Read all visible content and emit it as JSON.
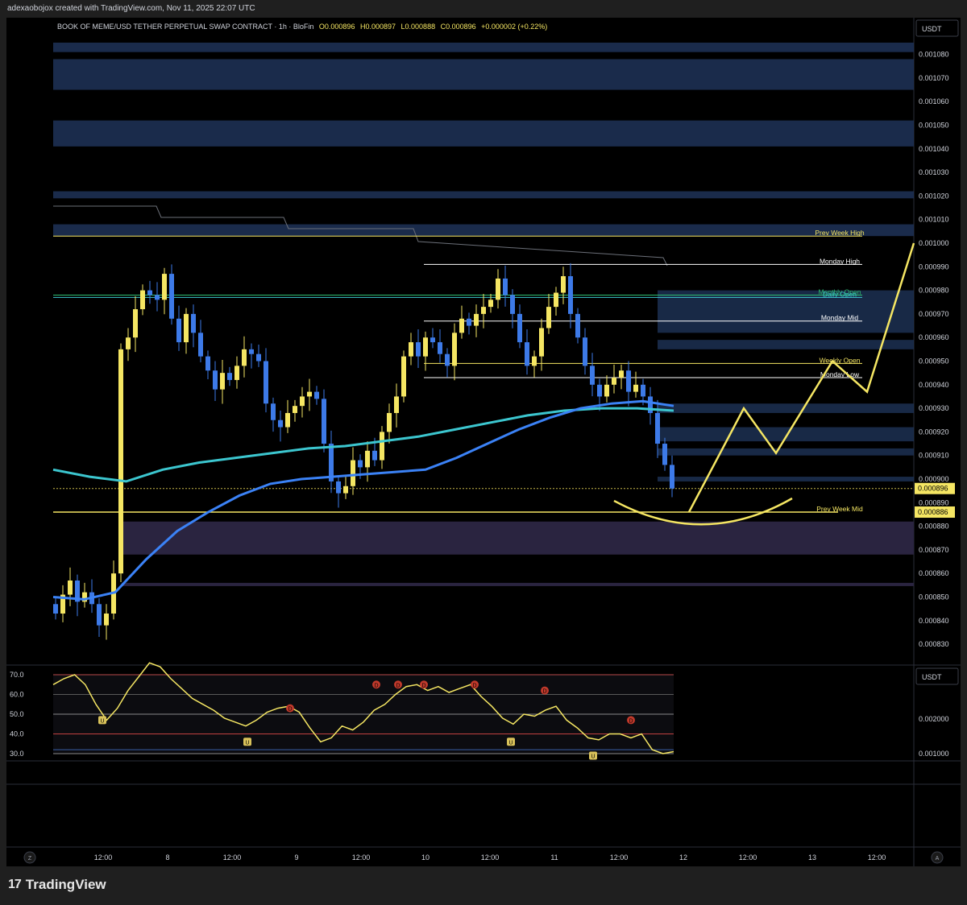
{
  "credit": "adexaobojox created with TradingView.com, Nov 11, 2025 22:07 UTC",
  "brand": {
    "logo": "17",
    "name": "TradingView"
  },
  "colors": {
    "background": "#000000",
    "bull": "#f5e663",
    "bear": "#3d7ae8",
    "ema_fast": "#3b82f6",
    "ema_slow": "#3cc6cf",
    "zone": "#1e3358",
    "purple_zone": "#2a2440",
    "projection": "#f5e663",
    "rsi": "#f5e663"
  },
  "header": {
    "symbol": "BOOK OF MEME/USD TETHER PERPETUAL SWAP CONTRACT · 1h · BloFin",
    "o": "O0.000896",
    "h": "H0.000897",
    "l": "L0.000888",
    "c": "C0.000896",
    "chg": "+0.000002 (+0.22%)"
  },
  "price_axis": {
    "currency": "USDT",
    "ticks": [
      "0.001080",
      "0.001070",
      "0.001060",
      "0.001050",
      "0.001040",
      "0.001030",
      "0.001020",
      "0.001010",
      "0.001000",
      "0.000990",
      "0.000980",
      "0.000970",
      "0.000960",
      "0.000950",
      "0.000940",
      "0.000930",
      "0.000920",
      "0.000910",
      "0.000900",
      "0.000890",
      "0.000880",
      "0.000870",
      "0.000860",
      "0.000850",
      "0.000840",
      "0.000830"
    ],
    "last_price": "0.000896",
    "level_price": "0.000886"
  },
  "time_axis": {
    "labels": [
      "12:00",
      "8",
      "12:00",
      "9",
      "12:00",
      "10",
      "12:00",
      "11",
      "12:00",
      "12",
      "12:00",
      "13",
      "12:00"
    ],
    "left_button": "Z",
    "right_button": "A"
  },
  "levels": [
    {
      "label": "Prev Week High",
      "price": 0.001003,
      "color": "#f5e663"
    },
    {
      "label": "Monday High",
      "price": 0.000991,
      "color": "#ffffff"
    },
    {
      "label": "Monthly Open",
      "price": 0.000978,
      "color": "#2fbf71"
    },
    {
      "label": "Daily Open",
      "price": 0.000977,
      "color": "#3cc6cf"
    },
    {
      "label": "Monday Mid",
      "price": 0.000967,
      "color": "#ffffff"
    },
    {
      "label": "Weekly Open",
      "price": 0.000949,
      "color": "#f5e663"
    },
    {
      "label": "Monday Low",
      "price": 0.000943,
      "color": "#ffffff"
    },
    {
      "label": "Prev Week Mid",
      "price": 0.000886,
      "color": "#f5e663"
    }
  ],
  "rsi": {
    "ticks": [
      "70.0",
      "60.0",
      "50.0",
      "40.0",
      "30.0"
    ],
    "right_currency": "USDT",
    "right_ticks": [
      "0.002000",
      "0.001000"
    ],
    "markers": [
      {
        "t": "D",
        "x": 360,
        "v": 53
      },
      {
        "t": "D",
        "x": 467,
        "v": 65
      },
      {
        "t": "D",
        "x": 494,
        "v": 65
      },
      {
        "t": "D",
        "x": 526,
        "v": 65
      },
      {
        "t": "D",
        "x": 589,
        "v": 65
      },
      {
        "t": "D",
        "x": 676,
        "v": 62
      },
      {
        "t": "D",
        "x": 783,
        "v": 47
      },
      {
        "t": "U",
        "x": 127,
        "v": 47
      },
      {
        "t": "U",
        "x": 307,
        "v": 36
      },
      {
        "t": "U",
        "x": 634,
        "v": 36
      },
      {
        "t": "U",
        "x": 736,
        "v": 29
      }
    ]
  },
  "chart_data": {
    "type": "candlestick",
    "title": "BOOK OF MEME/USD TETHER PERPETUAL SWAP CONTRACT · 1h · BloFin",
    "timeframe": "1h",
    "x_labels": [
      "12:00",
      "8",
      "12:00",
      "9",
      "12:00",
      "10",
      "12:00",
      "11",
      "12:00",
      "12",
      "12:00",
      "13",
      "12:00"
    ],
    "y_ticks": [
      "0.001080",
      "0.001070",
      "0.001060",
      "0.001050",
      "0.001040",
      "0.001030",
      "0.001020",
      "0.001010",
      "0.001000",
      "0.000990",
      "0.000980",
      "0.000970",
      "0.000960",
      "0.000950",
      "0.000940",
      "0.000930",
      "0.000920",
      "0.000910",
      "0.000900",
      "0.000890",
      "0.000880",
      "0.000870",
      "0.000860",
      "0.000850",
      "0.000840",
      "0.000830"
    ],
    "ylim": [
      0.000822,
      0.001089
    ],
    "ohlc_last": {
      "o": 0.000896,
      "h": 0.000897,
      "l": 0.000888,
      "c": 0.000896
    },
    "close_path": [
      0.000843,
      0.000851,
      0.000857,
      0.000848,
      0.000852,
      0.000847,
      0.000838,
      0.000843,
      0.00086,
      0.000955,
      0.00096,
      0.000972,
      0.00098,
      0.000978,
      0.000976,
      0.000987,
      0.000968,
      0.000958,
      0.00097,
      0.000962,
      0.000952,
      0.000946,
      0.000938,
      0.000945,
      0.000942,
      0.000948,
      0.000955,
      0.000953,
      0.00095,
      0.000932,
      0.000925,
      0.000922,
      0.000928,
      0.000931,
      0.000935,
      0.000937,
      0.000934,
      0.000915,
      0.000899,
      0.000894,
      0.000897,
      0.000908,
      0.000905,
      0.000912,
      0.000908,
      0.00092,
      0.000928,
      0.000935,
      0.000952,
      0.000958,
      0.000952,
      0.00096,
      0.000958,
      0.000953,
      0.000948,
      0.000962,
      0.000968,
      0.000965,
      0.00097,
      0.000973,
      0.000976,
      0.000985,
      0.000978,
      0.00097,
      0.000958,
      0.000948,
      0.000952,
      0.000964,
      0.000973,
      0.000979,
      0.000986,
      0.00097,
      0.00096,
      0.000948,
      0.00094,
      0.000935,
      0.00094,
      0.000943,
      0.000946,
      0.000937,
      0.00094,
      0.000935,
      0.000928,
      0.000915,
      0.000906,
      0.000896
    ],
    "ema_fast_path": [
      0.00085,
      0.000849,
      0.000852,
      0.000866,
      0.000878,
      0.000886,
      0.000893,
      0.000898,
      0.0009,
      0.000901,
      0.000902,
      0.000903,
      0.000904,
      0.000909,
      0.000915,
      0.000921,
      0.000926,
      0.00093,
      0.000932,
      0.000933,
      0.000931
    ],
    "ema_slow_path": [
      0.000904,
      0.000901,
      0.000899,
      0.000904,
      0.000907,
      0.000909,
      0.000911,
      0.000913,
      0.000914,
      0.000916,
      0.000918,
      0.000921,
      0.000924,
      0.000927,
      0.000929,
      0.00093,
      0.00093,
      0.000929
    ],
    "projection_path": [
      0.000886,
      0.00093,
      0.000911,
      0.00095,
      0.000937,
      0.001
    ],
    "rsi": {
      "values": [
        65,
        68,
        70,
        65,
        55,
        47,
        53,
        62,
        69,
        76,
        74,
        68,
        63,
        58,
        55,
        52,
        48,
        46,
        44,
        47,
        51,
        53,
        54,
        51,
        43,
        36,
        38,
        44,
        42,
        46,
        52,
        55,
        60,
        64,
        65,
        62,
        64,
        61,
        63,
        65,
        59,
        54,
        48,
        45,
        50,
        49,
        52,
        54,
        47,
        43,
        38,
        37,
        40,
        40,
        38,
        40,
        32,
        30,
        31
      ],
      "ylim": [
        25,
        75
      ]
    }
  }
}
